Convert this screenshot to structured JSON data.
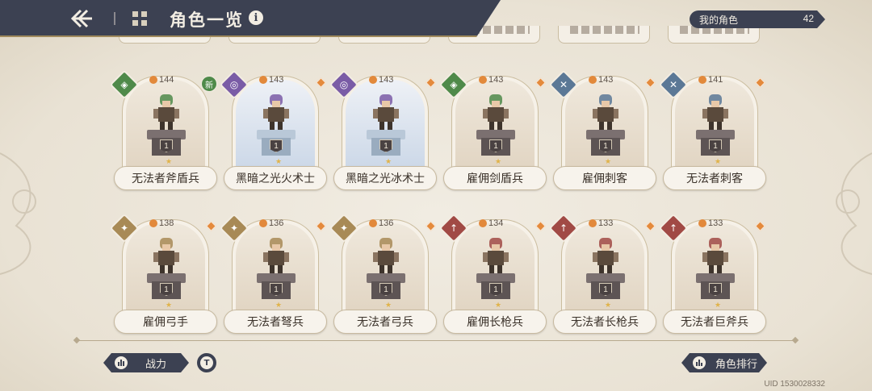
{
  "header": {
    "title": "角色一览",
    "my_chars_label": "我的角色",
    "my_chars_count": "42"
  },
  "cards": [
    {
      "name": "无法者斧盾兵",
      "power": "144",
      "class_color": "#4f8a4a",
      "class_icon": "shield-class-icon",
      "badge": "新",
      "level": "1",
      "theme": "normal"
    },
    {
      "name": "黑暗之光火术士",
      "power": "143",
      "class_color": "#7a5ca6",
      "class_icon": "spiral-class-icon",
      "badge": "",
      "level": "1",
      "theme": "blue"
    },
    {
      "name": "黑暗之光冰术士",
      "power": "143",
      "class_color": "#7a5ca6",
      "class_icon": "spiral-class-icon",
      "badge": "",
      "level": "1",
      "theme": "blue"
    },
    {
      "name": "雇佣剑盾兵",
      "power": "143",
      "class_color": "#4f8a4a",
      "class_icon": "shield-class-icon",
      "badge": "",
      "level": "1",
      "theme": "normal"
    },
    {
      "name": "雇佣刺客",
      "power": "143",
      "class_color": "#5b7896",
      "class_icon": "crossed-blades-class-icon",
      "badge": "",
      "level": "1",
      "theme": "normal"
    },
    {
      "name": "无法者刺客",
      "power": "141",
      "class_color": "#5b7896",
      "class_icon": "crossed-blades-class-icon",
      "badge": "",
      "level": "1",
      "theme": "normal"
    },
    {
      "name": "雇佣弓手",
      "power": "138",
      "class_color": "#a88a56",
      "class_icon": "star-class-icon",
      "badge": "",
      "level": "1",
      "theme": "normal"
    },
    {
      "name": "无法者弩兵",
      "power": "136",
      "class_color": "#a88a56",
      "class_icon": "star-class-icon",
      "badge": "",
      "level": "1",
      "theme": "normal"
    },
    {
      "name": "无法者弓兵",
      "power": "136",
      "class_color": "#a88a56",
      "class_icon": "star-class-icon",
      "badge": "",
      "level": "1",
      "theme": "normal"
    },
    {
      "name": "雇佣长枪兵",
      "power": "134",
      "class_color": "#a14a45",
      "class_icon": "spear-class-icon",
      "badge": "",
      "level": "1",
      "theme": "normal"
    },
    {
      "name": "无法者长枪兵",
      "power": "133",
      "class_color": "#a14a45",
      "class_icon": "spear-class-icon",
      "badge": "",
      "level": "1",
      "theme": "normal"
    },
    {
      "name": "无法者巨斧兵",
      "power": "133",
      "class_color": "#a14a45",
      "class_icon": "spear-class-icon",
      "badge": "",
      "level": "1",
      "theme": "normal"
    }
  ],
  "footer": {
    "power_label": "战力",
    "filter_label": "T",
    "rank_label": "角色排行",
    "uid": "UID 1530028332"
  }
}
